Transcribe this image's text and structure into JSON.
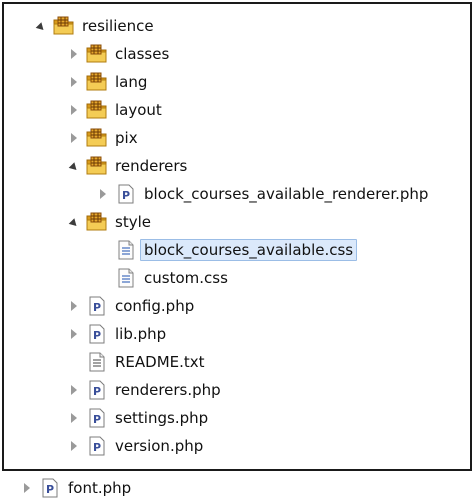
{
  "tree": {
    "root": {
      "label": "resilience"
    },
    "folders": {
      "classes": "classes",
      "lang": "lang",
      "layout": "layout",
      "pix": "pix",
      "renderers": "renderers",
      "style": "style"
    },
    "files": {
      "renderer_php": "block_courses_available_renderer.php",
      "block_css": "block_courses_available.css",
      "custom_css": "custom.css",
      "config_php": "config.php",
      "lib_php": "lib.php",
      "readme": "README.txt",
      "renderers_php": "renderers.php",
      "settings_php": "settings.php",
      "version_php": "version.php",
      "font_php": "font.php"
    },
    "selected": "block_courses_available.css",
    "icons": {
      "package": "package-folder-icon",
      "php": "php-file-icon",
      "css": "css-file-icon",
      "text": "text-file-icon"
    },
    "colors": {
      "selection_bg": "#dbe9fb",
      "selection_border": "#9bbde6",
      "folder": "#e8b830",
      "php_letter": "#3a4f9a"
    }
  }
}
